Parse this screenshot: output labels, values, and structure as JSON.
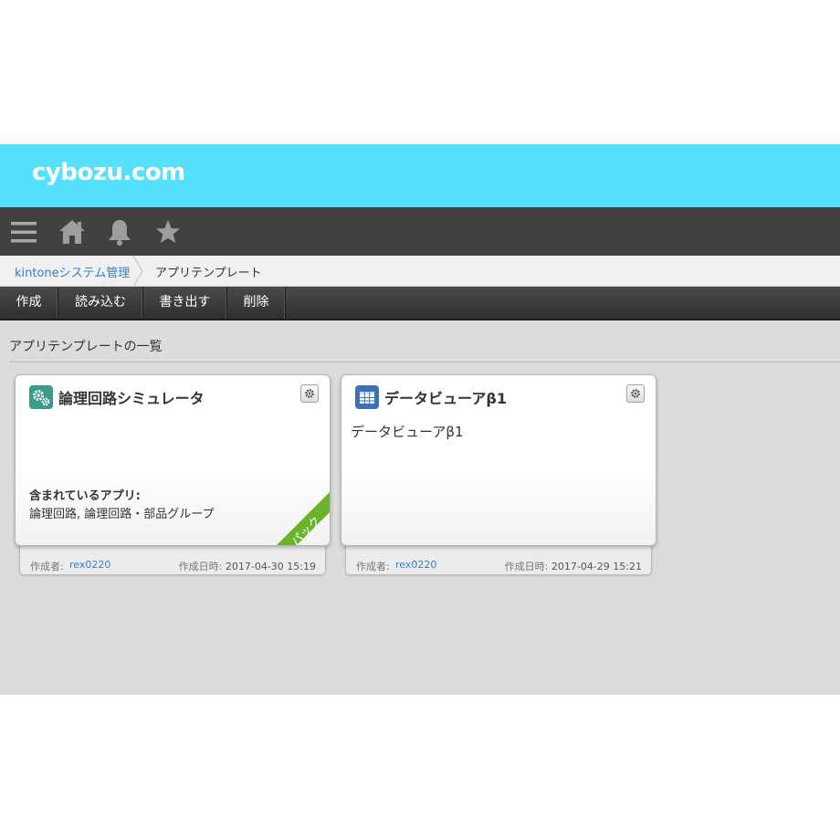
{
  "header": {
    "logo": "cybozu.com",
    "brand_color": "#55e0fd"
  },
  "nav": {
    "icons": [
      "menu-icon",
      "home-icon",
      "bell-icon",
      "star-icon"
    ]
  },
  "breadcrumb": {
    "parent": "kintoneシステム管理",
    "current": "アプリテンプレート"
  },
  "toolbar": {
    "buttons": [
      "作成",
      "読み込む",
      "書き出す",
      "削除"
    ]
  },
  "section": {
    "title": "アプリテンプレートの一覧"
  },
  "cards": [
    {
      "title": "論理回路シミュレータ",
      "icon": "gears-icon",
      "icon_color": "#3c9a8c",
      "included_label": "含まれているアプリ:",
      "included_apps": "論理回路, 論理回路・部品グループ",
      "ribbon": "パック",
      "ribbon_color": "#6ab42d",
      "creator_label": "作成者:",
      "creator": "rex0220",
      "date_label": "作成日時:",
      "date": "2017-04-30 15:19"
    },
    {
      "title": "データビューアβ1",
      "icon": "table-icon",
      "icon_color": "#3f6fb5",
      "description": "データビューアβ1",
      "creator_label": "作成者:",
      "creator": "rex0220",
      "date_label": "作成日時:",
      "date": "2017-04-29 15:21"
    }
  ]
}
